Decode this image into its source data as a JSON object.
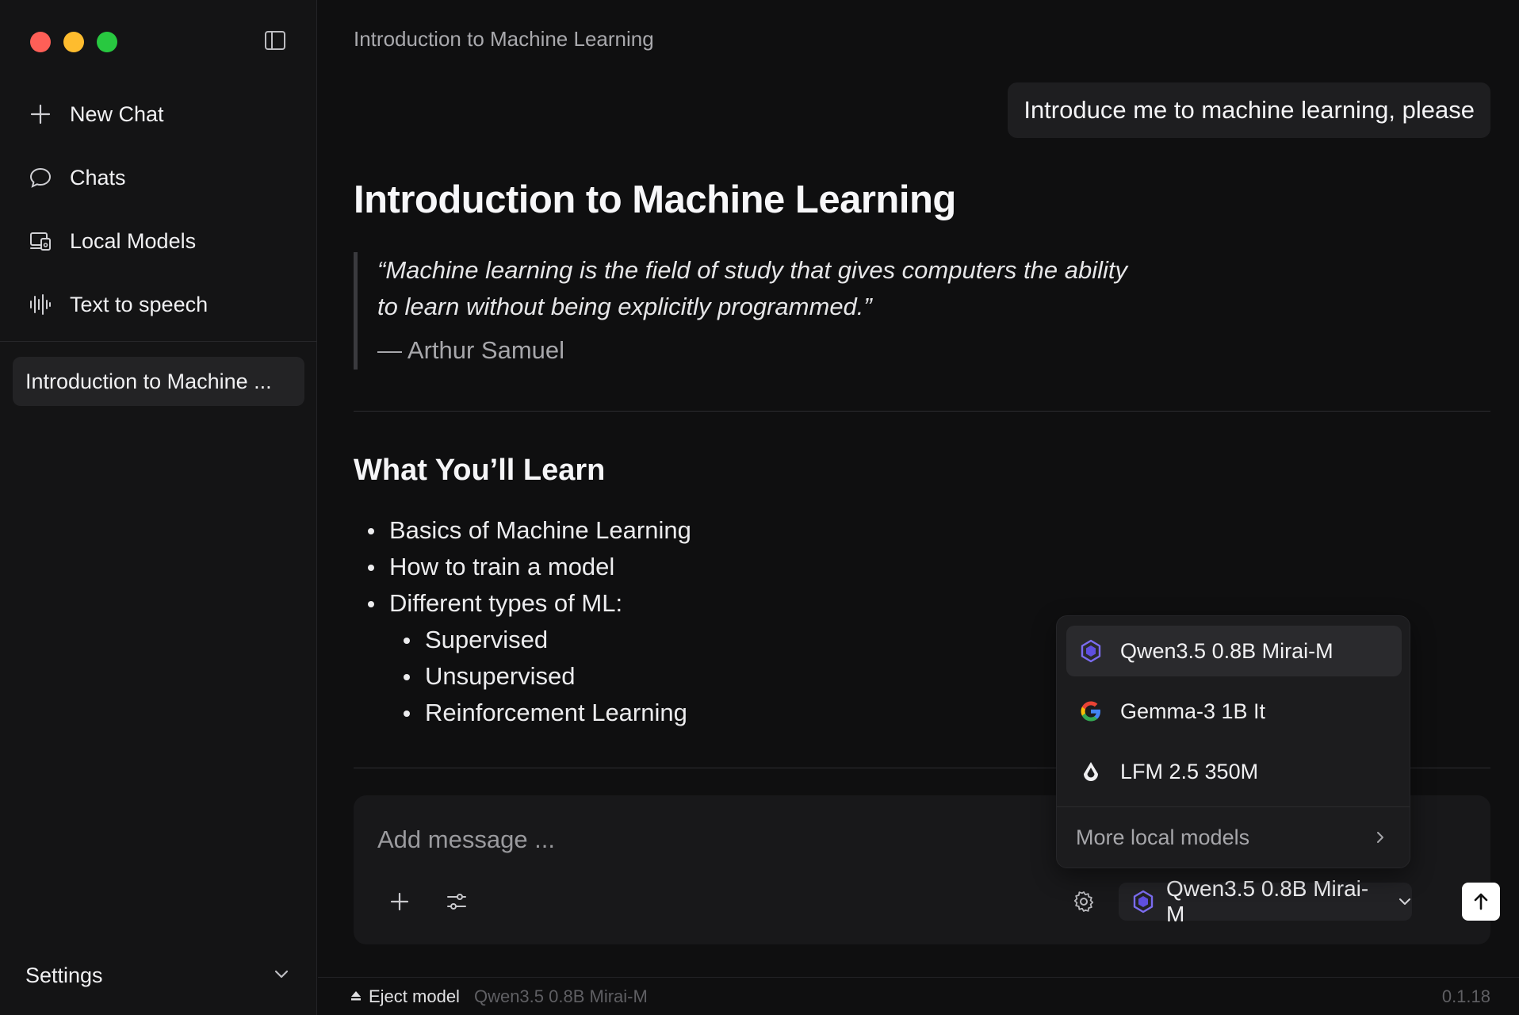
{
  "sidebar": {
    "items": [
      {
        "label": "New Chat",
        "icon": "plus-icon"
      },
      {
        "label": "Chats",
        "icon": "chat-bubble-icon"
      },
      {
        "label": "Local Models",
        "icon": "local-models-icon"
      },
      {
        "label": "Text to speech",
        "icon": "waveform-icon"
      }
    ],
    "chats": [
      {
        "label": "Introduction to Machine ..."
      }
    ],
    "settings_label": "Settings"
  },
  "header": {
    "title": "Introduction to Machine Learning"
  },
  "conversation": {
    "user_message": "Introduce me to machine learning, please",
    "response": {
      "title": "Introduction to Machine Learning",
      "quote": "“Machine learning is the field of study that gives computers the ability to learn without being explicitly programmed.”",
      "quote_author": "— Arthur Samuel",
      "section_title": "What You’ll Learn",
      "bullets": [
        "Basics of Machine Learning",
        "How to train a model",
        "Different types of ML:"
      ],
      "sub_bullets": [
        "Supervised",
        "Unsupervised",
        "Reinforcement Learning"
      ]
    }
  },
  "composer": {
    "placeholder": "Add message ...",
    "selected_model": "Qwen3.5 0.8B Mirai-M"
  },
  "model_dropdown": {
    "options": [
      {
        "label": "Qwen3.5 0.8B Mirai-M",
        "icon": "qwen-icon",
        "selected": true
      },
      {
        "label": "Gemma-3 1B It",
        "icon": "google-icon",
        "selected": false
      },
      {
        "label": "LFM 2.5 350M",
        "icon": "liquid-icon",
        "selected": false
      }
    ],
    "more_label": "More local models"
  },
  "statusbar": {
    "eject_label": "Eject model",
    "model": "Qwen3.5 0.8B Mirai-M",
    "version": "0.1.18"
  },
  "colors": {
    "background": "#0f0f10",
    "sidebar": "#141415",
    "accent_qwen": "#6c5ce7",
    "close": "#ff5f57",
    "minimize": "#febc2e",
    "zoom": "#28c840"
  }
}
